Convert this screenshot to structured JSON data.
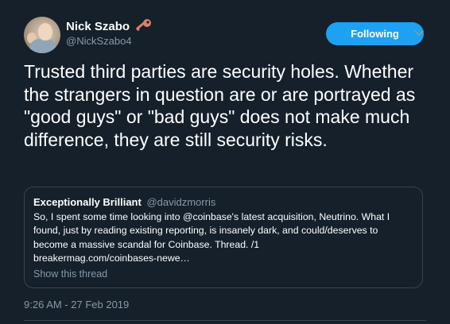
{
  "author": {
    "display_name": "Nick Szabo",
    "handle": "@NickSzabo4",
    "badge_icon": "key-icon"
  },
  "follow_button": {
    "label": "Following",
    "color": "#1da1f2"
  },
  "menu_icon": "chevron-down-icon",
  "tweet": {
    "text": "Trusted third parties are security holes. Whether the strangers in question are or are portrayed as \"good guys\" or \"bad guys\" does not make much difference, they are still security risks."
  },
  "quoted_tweet": {
    "name": "Exceptionally Brilliant",
    "handle": "@davidzmorris",
    "text": "So, I spent some time looking into @coinbase's latest acquisition, Neutrino. What I found, just by reading existing reporting, is insanely dark, and could/deserves to become a massive scandal for Coinbase. Thread. /1",
    "link": "breakermag.com/coinbases-newe…",
    "show_thread_label": "Show this thread"
  },
  "timestamp": "9:26 AM - 27 Feb 2019",
  "colors": {
    "background": "#15202b",
    "secondary_text": "#8899a6",
    "border": "#38444d",
    "key_icon": "#d9826a"
  }
}
